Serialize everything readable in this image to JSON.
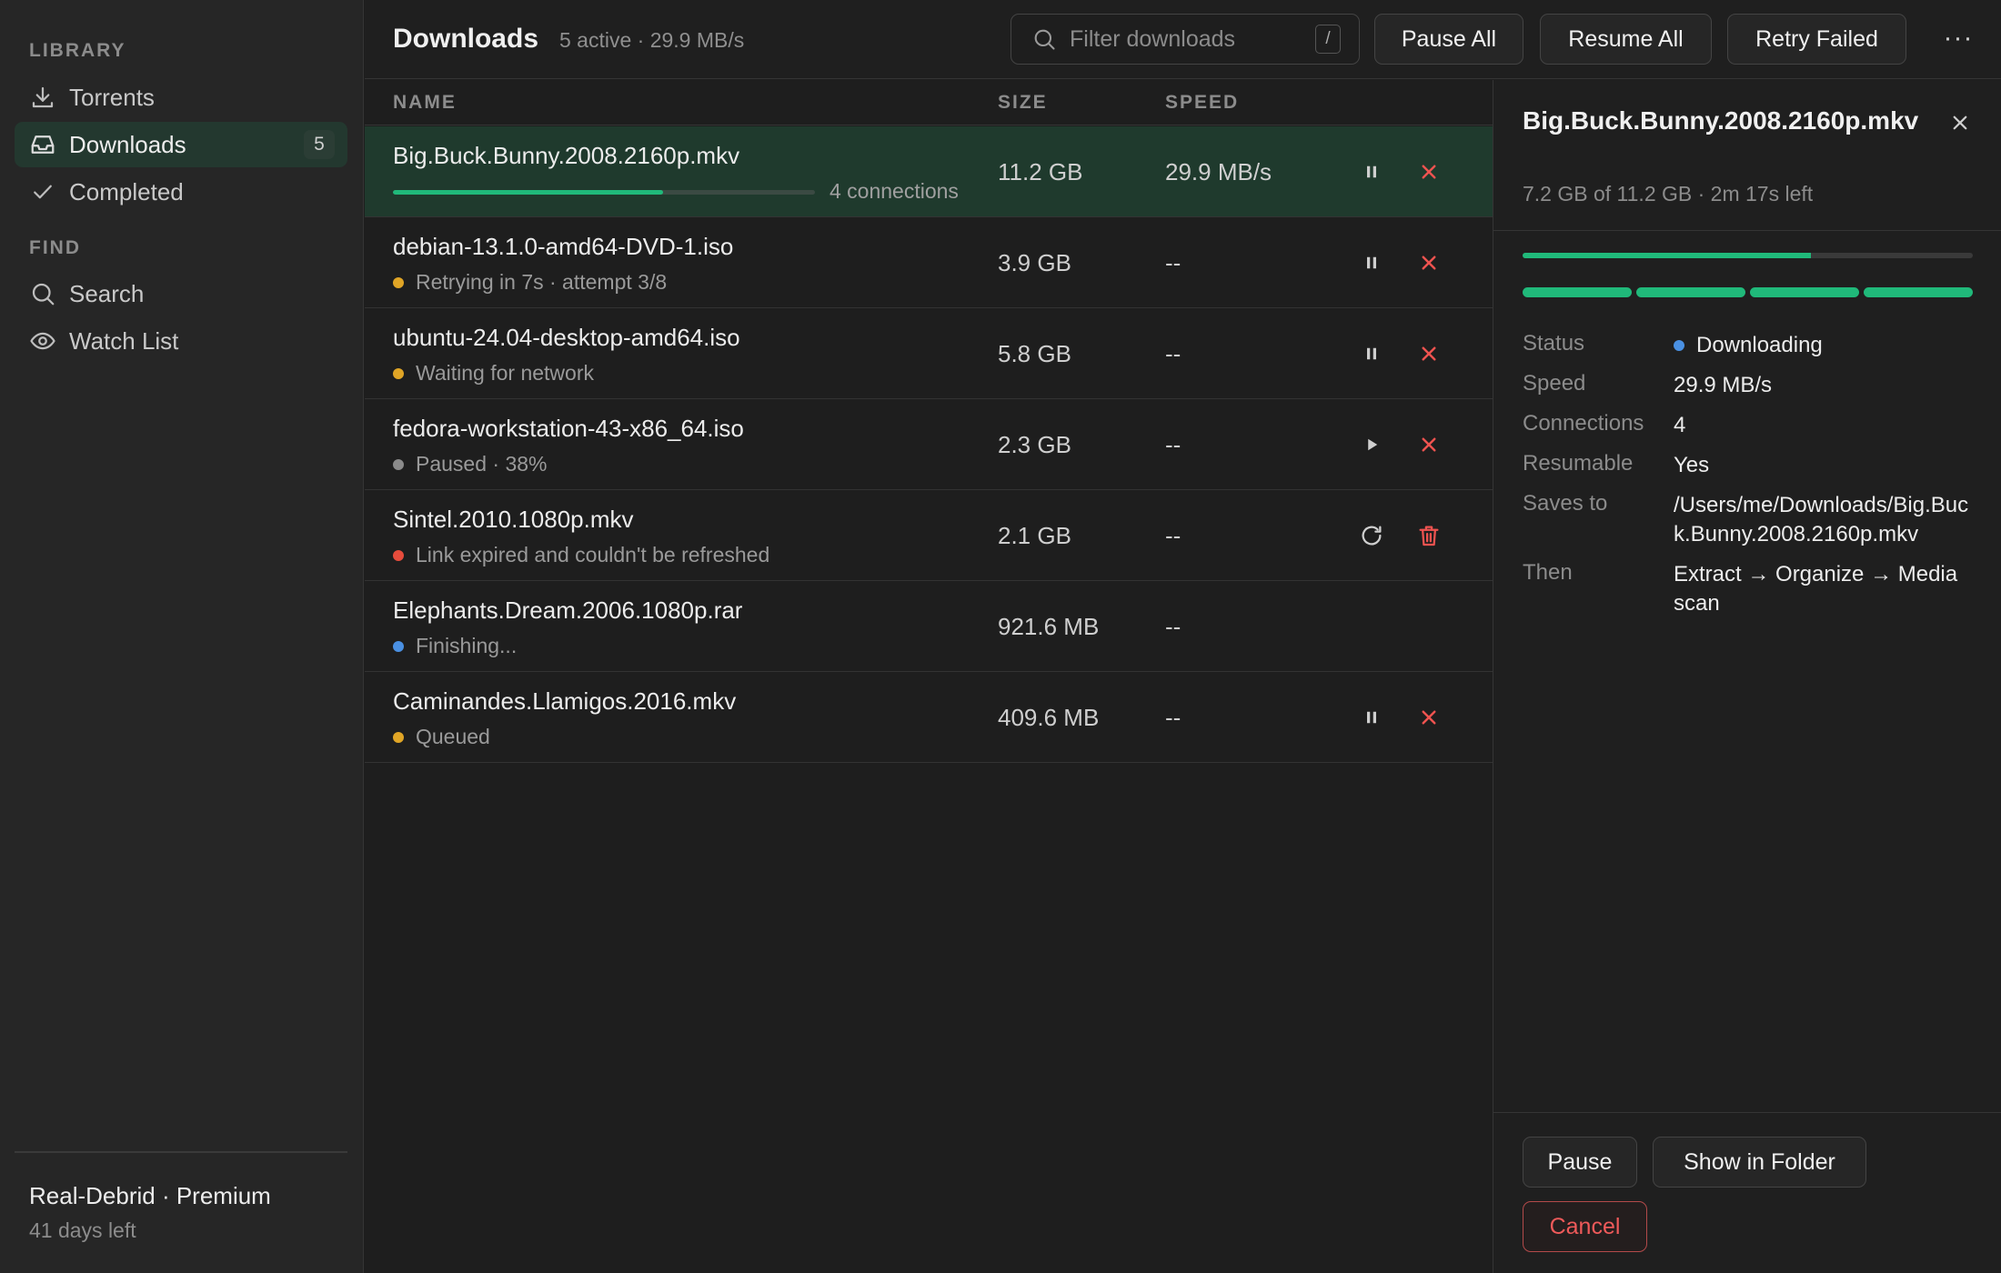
{
  "colors": {
    "accent_green": "#20b97a",
    "selected_row": "#1f3a2d",
    "danger_red": "#ef5350",
    "status_yellow": "#e0a526",
    "status_blue": "#4a90e2",
    "status_gray": "#8a8a8a",
    "status_red": "#e74c3c"
  },
  "sidebar": {
    "section_library": "LIBRARY",
    "section_find": "FIND",
    "items": [
      {
        "label": "Torrents",
        "icon": "download-icon"
      },
      {
        "label": "Downloads",
        "icon": "inbox-icon",
        "badge": "5",
        "active": true
      },
      {
        "label": "Completed",
        "icon": "check-icon"
      },
      {
        "label": "Search",
        "icon": "search-icon"
      },
      {
        "label": "Watch List",
        "icon": "eye-icon"
      }
    ],
    "account": {
      "name": "Real-Debrid · Premium",
      "sub": "41 days left"
    }
  },
  "header": {
    "title": "Downloads",
    "subtitle": "5 active · 29.9 MB/s",
    "search_placeholder": "Filter downloads",
    "search_shortcut": "/",
    "buttons": {
      "pause_all": "Pause All",
      "resume_all": "Resume All",
      "retry_failed": "Retry Failed"
    },
    "more": "···"
  },
  "table": {
    "columns": {
      "name": "NAME",
      "size": "SIZE",
      "speed": "SPEED"
    },
    "rows": [
      {
        "name": "Big.Buck.Bunny.2008.2160p.mkv",
        "progress": 0.64,
        "connections": "4 connections",
        "size": "11.2 GB",
        "speed": "29.9 MB/s",
        "actions": [
          "pause",
          "cancel"
        ]
      },
      {
        "name": "debian-13.1.0-amd64-DVD-1.iso",
        "status": "Retrying in 7s · attempt 3/8",
        "status_color": "#e0a526",
        "size": "3.9 GB",
        "speed": "--",
        "actions": [
          "pause",
          "cancel"
        ]
      },
      {
        "name": "ubuntu-24.04-desktop-amd64.iso",
        "status": "Waiting for network",
        "status_color": "#e0a526",
        "size": "5.8 GB",
        "speed": "--",
        "actions": [
          "pause",
          "cancel"
        ]
      },
      {
        "name": "fedora-workstation-43-x86_64.iso",
        "status": "Paused · 38%",
        "status_color": "#8a8a8a",
        "size": "2.3 GB",
        "speed": "--",
        "actions": [
          "play",
          "cancel"
        ]
      },
      {
        "name": "Sintel.2010.1080p.mkv",
        "status": "Link expired and couldn't be refreshed",
        "status_color": "#e74c3c",
        "size": "2.1 GB",
        "speed": "--",
        "actions": [
          "retry",
          "delete"
        ]
      },
      {
        "name": "Elephants.Dream.2006.1080p.rar",
        "status": "Finishing...",
        "status_color": "#4a90e2",
        "size": "921.6 MB",
        "speed": "--",
        "actions": []
      },
      {
        "name": "Caminandes.Llamigos.2016.mkv",
        "status": "Queued",
        "status_color": "#e0a526",
        "size": "409.6 MB",
        "speed": "--",
        "actions": [
          "pause",
          "cancel"
        ]
      }
    ]
  },
  "detail": {
    "title": "Big.Buck.Bunny.2008.2160p.mkv",
    "subtitle": "7.2 GB of 11.2 GB · 2m 17s left",
    "progress": 0.64,
    "connections_count": 4,
    "fields": [
      {
        "key": "Status",
        "value": "Downloading",
        "dot": "#4a90e2"
      },
      {
        "key": "Speed",
        "value": "29.9 MB/s"
      },
      {
        "key": "Connections",
        "value": "4"
      },
      {
        "key": "Resumable",
        "value": "Yes"
      },
      {
        "key": "Saves to",
        "value": "/Users/me/Downloads/Big.Buck.Bunny.2008.2160p.mkv"
      },
      {
        "key": "Then",
        "value": "Extract → Organize → Media scan"
      }
    ],
    "buttons": {
      "pause": "Pause",
      "show_in_folder": "Show in Folder",
      "cancel": "Cancel"
    }
  }
}
